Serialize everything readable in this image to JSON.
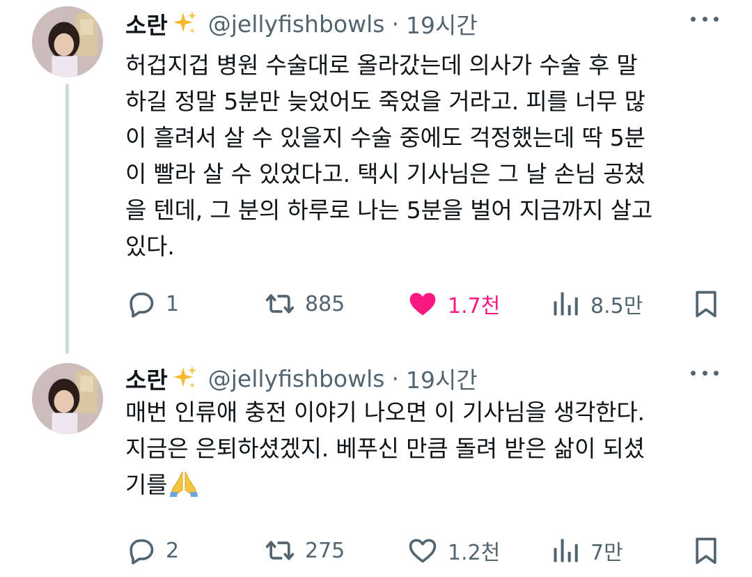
{
  "tweets": [
    {
      "display_name": "소란",
      "name_emoji": "sparkles-icon",
      "handle": "@jellyfishbowls",
      "separator": "·",
      "time": "19시간",
      "text": "허겁지겁 병원 수술대로 올라갔는데 의사가 수술 후 말\n하길 정말 5분만 늦었어도 죽었을 거라고. 피를 너무 많\n이 흘려서 살 수 있을지 수술 중에도 걱정했는데 딱 5분\n이 빨라 살 수 있었다고. 택시 기사님은 그 날 손님 공쳤\n을 텐데, 그 분의 하루로 나는 5분을 벌어 지금까지 살고\n있다.",
      "replies": "1",
      "retweets": "885",
      "likes": "1.7천",
      "liked": true,
      "views": "8.5만"
    },
    {
      "display_name": "소란",
      "name_emoji": "sparkles-icon",
      "handle": "@jellyfishbowls",
      "separator": "·",
      "time": "19시간",
      "text": "매번 인류애 충전 이야기 나오면 이 기사님을 생각한다.\n지금은 은퇴하셨겠지. 베푸신 만큼 돌려 받은 삶이 되셨\n기를",
      "text_emoji": "folded-hands-icon",
      "replies": "2",
      "retweets": "275",
      "likes": "1.2천",
      "liked": false,
      "views": "7만"
    }
  ],
  "colors": {
    "text": "#0f1419",
    "secondary": "#536471",
    "like_active": "#f91880",
    "thread_line": "#cfd9de"
  }
}
